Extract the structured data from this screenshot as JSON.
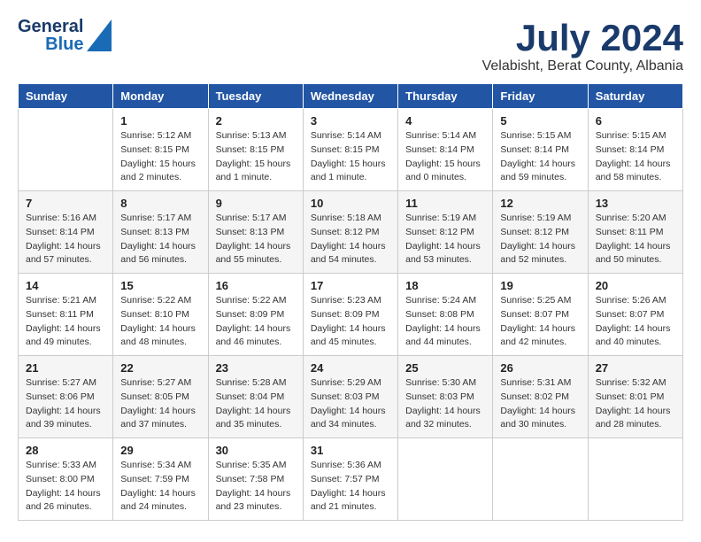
{
  "logo": {
    "line1": "General",
    "line2": "Blue"
  },
  "title": "July 2024",
  "subtitle": "Velabisht, Berat County, Albania",
  "days_of_week": [
    "Sunday",
    "Monday",
    "Tuesday",
    "Wednesday",
    "Thursday",
    "Friday",
    "Saturday"
  ],
  "weeks": [
    [
      {
        "day": "",
        "info": ""
      },
      {
        "day": "1",
        "info": "Sunrise: 5:12 AM\nSunset: 8:15 PM\nDaylight: 15 hours\nand 2 minutes."
      },
      {
        "day": "2",
        "info": "Sunrise: 5:13 AM\nSunset: 8:15 PM\nDaylight: 15 hours\nand 1 minute."
      },
      {
        "day": "3",
        "info": "Sunrise: 5:14 AM\nSunset: 8:15 PM\nDaylight: 15 hours\nand 1 minute."
      },
      {
        "day": "4",
        "info": "Sunrise: 5:14 AM\nSunset: 8:14 PM\nDaylight: 15 hours\nand 0 minutes."
      },
      {
        "day": "5",
        "info": "Sunrise: 5:15 AM\nSunset: 8:14 PM\nDaylight: 14 hours\nand 59 minutes."
      },
      {
        "day": "6",
        "info": "Sunrise: 5:15 AM\nSunset: 8:14 PM\nDaylight: 14 hours\nand 58 minutes."
      }
    ],
    [
      {
        "day": "7",
        "info": "Sunrise: 5:16 AM\nSunset: 8:14 PM\nDaylight: 14 hours\nand 57 minutes."
      },
      {
        "day": "8",
        "info": "Sunrise: 5:17 AM\nSunset: 8:13 PM\nDaylight: 14 hours\nand 56 minutes."
      },
      {
        "day": "9",
        "info": "Sunrise: 5:17 AM\nSunset: 8:13 PM\nDaylight: 14 hours\nand 55 minutes."
      },
      {
        "day": "10",
        "info": "Sunrise: 5:18 AM\nSunset: 8:12 PM\nDaylight: 14 hours\nand 54 minutes."
      },
      {
        "day": "11",
        "info": "Sunrise: 5:19 AM\nSunset: 8:12 PM\nDaylight: 14 hours\nand 53 minutes."
      },
      {
        "day": "12",
        "info": "Sunrise: 5:19 AM\nSunset: 8:12 PM\nDaylight: 14 hours\nand 52 minutes."
      },
      {
        "day": "13",
        "info": "Sunrise: 5:20 AM\nSunset: 8:11 PM\nDaylight: 14 hours\nand 50 minutes."
      }
    ],
    [
      {
        "day": "14",
        "info": "Sunrise: 5:21 AM\nSunset: 8:11 PM\nDaylight: 14 hours\nand 49 minutes."
      },
      {
        "day": "15",
        "info": "Sunrise: 5:22 AM\nSunset: 8:10 PM\nDaylight: 14 hours\nand 48 minutes."
      },
      {
        "day": "16",
        "info": "Sunrise: 5:22 AM\nSunset: 8:09 PM\nDaylight: 14 hours\nand 46 minutes."
      },
      {
        "day": "17",
        "info": "Sunrise: 5:23 AM\nSunset: 8:09 PM\nDaylight: 14 hours\nand 45 minutes."
      },
      {
        "day": "18",
        "info": "Sunrise: 5:24 AM\nSunset: 8:08 PM\nDaylight: 14 hours\nand 44 minutes."
      },
      {
        "day": "19",
        "info": "Sunrise: 5:25 AM\nSunset: 8:07 PM\nDaylight: 14 hours\nand 42 minutes."
      },
      {
        "day": "20",
        "info": "Sunrise: 5:26 AM\nSunset: 8:07 PM\nDaylight: 14 hours\nand 40 minutes."
      }
    ],
    [
      {
        "day": "21",
        "info": "Sunrise: 5:27 AM\nSunset: 8:06 PM\nDaylight: 14 hours\nand 39 minutes."
      },
      {
        "day": "22",
        "info": "Sunrise: 5:27 AM\nSunset: 8:05 PM\nDaylight: 14 hours\nand 37 minutes."
      },
      {
        "day": "23",
        "info": "Sunrise: 5:28 AM\nSunset: 8:04 PM\nDaylight: 14 hours\nand 35 minutes."
      },
      {
        "day": "24",
        "info": "Sunrise: 5:29 AM\nSunset: 8:03 PM\nDaylight: 14 hours\nand 34 minutes."
      },
      {
        "day": "25",
        "info": "Sunrise: 5:30 AM\nSunset: 8:03 PM\nDaylight: 14 hours\nand 32 minutes."
      },
      {
        "day": "26",
        "info": "Sunrise: 5:31 AM\nSunset: 8:02 PM\nDaylight: 14 hours\nand 30 minutes."
      },
      {
        "day": "27",
        "info": "Sunrise: 5:32 AM\nSunset: 8:01 PM\nDaylight: 14 hours\nand 28 minutes."
      }
    ],
    [
      {
        "day": "28",
        "info": "Sunrise: 5:33 AM\nSunset: 8:00 PM\nDaylight: 14 hours\nand 26 minutes."
      },
      {
        "day": "29",
        "info": "Sunrise: 5:34 AM\nSunset: 7:59 PM\nDaylight: 14 hours\nand 24 minutes."
      },
      {
        "day": "30",
        "info": "Sunrise: 5:35 AM\nSunset: 7:58 PM\nDaylight: 14 hours\nand 23 minutes."
      },
      {
        "day": "31",
        "info": "Sunrise: 5:36 AM\nSunset: 7:57 PM\nDaylight: 14 hours\nand 21 minutes."
      },
      {
        "day": "",
        "info": ""
      },
      {
        "day": "",
        "info": ""
      },
      {
        "day": "",
        "info": ""
      }
    ]
  ]
}
